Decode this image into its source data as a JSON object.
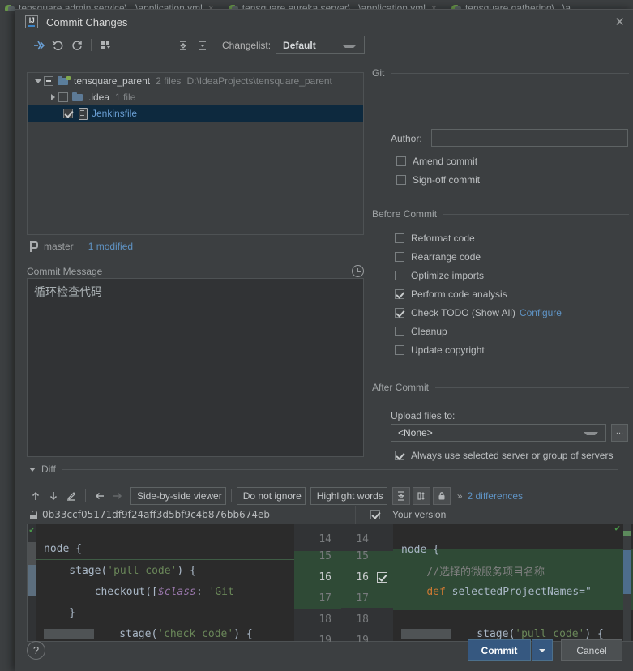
{
  "editor_tabs": [
    {
      "label": "tensquare admin service\\...\\application.yml",
      "icon": "yaml-file-icon",
      "close": "×"
    },
    {
      "label": "tensquare eureka server\\...\\application.yml",
      "icon": "yaml-file-icon",
      "close": "×"
    },
    {
      "label": "tensquare gathering\\...\\a",
      "icon": "yaml-file-icon",
      "close": ""
    }
  ],
  "dialog": {
    "title": "Commit Changes",
    "close_label": "✕",
    "logo": "intellij-idea-icon"
  },
  "toolbar": {
    "icons": [
      {
        "name": "show-diff-icon",
        "glyph": "⬌"
      },
      {
        "name": "revert-icon",
        "glyph": "↶"
      },
      {
        "name": "refresh-icon",
        "glyph": "↻"
      },
      {
        "name": "group-by-icon",
        "glyph": "⠿"
      },
      {
        "name": "expand-all-icon",
        "glyph": "⇕"
      },
      {
        "name": "collapse-all-icon",
        "glyph": "⇕"
      }
    ],
    "changelist_label": "Changelist:",
    "changelist_value": "Default"
  },
  "file_tree": {
    "rows": [
      {
        "name": "tensquare_parent",
        "meta": "2 files",
        "path": "D:\\IdeaProjects\\tensquare_parent",
        "checkbox": "dash",
        "twisty": "down",
        "icon": "module-folder-icon",
        "indent": 0,
        "selected": false,
        "modified": false
      },
      {
        "name": ".idea",
        "meta": "1 file",
        "path": "",
        "checkbox": "unchecked",
        "twisty": "right",
        "icon": "folder-icon",
        "indent": 1,
        "selected": false,
        "modified": false
      },
      {
        "name": "Jenkinsfile",
        "meta": "",
        "path": "",
        "checkbox": "checked",
        "twisty": "none",
        "icon": "file-icon",
        "indent": 2,
        "selected": true,
        "modified": true
      }
    ]
  },
  "branch_bar": {
    "branch": "master",
    "modified": "1 modified",
    "icon": "branch-icon"
  },
  "commit_message": {
    "label": "Commit Message",
    "value": "循环检查代码",
    "history_icon": "clock-icon"
  },
  "git_section": {
    "title": "Git",
    "author_label": "Author:",
    "author_value": "",
    "checkboxes": [
      {
        "label": "Amend commit",
        "checked": false
      },
      {
        "label": "Sign-off commit",
        "checked": false
      }
    ]
  },
  "before_commit": {
    "title": "Before Commit",
    "checkboxes": [
      {
        "label": "Reformat code",
        "checked": false,
        "link": ""
      },
      {
        "label": "Rearrange code",
        "checked": false,
        "link": ""
      },
      {
        "label": "Optimize imports",
        "checked": false,
        "link": ""
      },
      {
        "label": "Perform code analysis",
        "checked": true,
        "link": ""
      },
      {
        "label": "Check TODO (Show All)",
        "checked": true,
        "link": "Configure"
      },
      {
        "label": "Cleanup",
        "checked": false,
        "link": ""
      },
      {
        "label": "Update copyright",
        "checked": false,
        "link": ""
      }
    ]
  },
  "after_commit": {
    "title": "After Commit",
    "upload_label": "Upload files to:",
    "upload_value": "<None>",
    "browse_label": "...",
    "always_use_label": "Always use selected server or group of servers",
    "always_use_checked": true
  },
  "diff_section": {
    "title": "Diff",
    "toolbar": {
      "prev_diff_icon": "arrow-up-icon",
      "next_diff_icon": "arrow-down-icon",
      "edit_icon": "pencil-icon",
      "apply_left_icon": "arrow-left-icon",
      "apply_right_icon": "arrow-right-icon",
      "viewer_mode": "Side-by-side viewer",
      "ignore_mode": "Do not ignore",
      "highlight_mode": "Highlight words",
      "collapse_icon": "collapse-unchanged-icon",
      "whitespace_icon": "show-whitespace-icon",
      "lock_icon": "read-only-lock-icon",
      "more_glyph": "»",
      "differences": "2 differences"
    },
    "left_revision": "0b33ccf05171df9f24aff3d5bf9c4b876bb674eb",
    "left_revision_icon": "lock-icon",
    "right_revision": "Your version",
    "right_revision_checked": true,
    "line_numbers_left": [
      "14",
      "15",
      "16",
      "17",
      "18",
      "19"
    ],
    "line_numbers_right": [
      "14",
      "15",
      "16",
      "17",
      "18",
      "19"
    ],
    "left_lines": [
      {
        "indent": 0,
        "tokens": [
          {
            "t": "node {",
            "c": "txt"
          }
        ],
        "added": false
      },
      {
        "indent": 0,
        "tokens": [
          {
            "t": "    stage(",
            "c": "txt"
          },
          {
            "t": "'pull code'",
            "c": "str"
          },
          {
            "t": ") {",
            "c": "txt"
          }
        ],
        "added": false
      },
      {
        "indent": 0,
        "tokens": [
          {
            "t": "        checkout([",
            "c": "txt"
          },
          {
            "t": "$class",
            "c": "fld"
          },
          {
            "t": ": ",
            "c": "txt"
          },
          {
            "t": "'Git",
            "c": "str"
          }
        ],
        "added": false
      },
      {
        "indent": 0,
        "tokens": [
          {
            "t": "    }",
            "c": "txt"
          }
        ],
        "added": false
      },
      {
        "indent": 0,
        "tokens": [
          {
            "t": "    stage(",
            "c": "txt"
          },
          {
            "t": "'check code'",
            "c": "str"
          },
          {
            "t": ") {",
            "c": "txt"
          }
        ],
        "added": false
      }
    ],
    "right_lines": [
      {
        "tokens": [
          {
            "t": "node {",
            "c": "txt"
          }
        ],
        "added": false
      },
      {
        "tokens": [
          {
            "t": "    //选择的微服务项目名称",
            "c": "cmt"
          }
        ],
        "added": true
      },
      {
        "tokens": [
          {
            "t": "    ",
            "c": "txt"
          },
          {
            "t": "def",
            "c": "kw"
          },
          {
            "t": " selectedProjectNames=\"",
            "c": "txt"
          }
        ],
        "added": true
      },
      {
        "tokens": [
          {
            "t": "",
            "c": "txt"
          }
        ],
        "added": true
      },
      {
        "tokens": [
          {
            "t": "    stage(",
            "c": "txt"
          },
          {
            "t": "'pull code'",
            "c": "str"
          },
          {
            "t": ") {",
            "c": "txt"
          }
        ],
        "added": false
      }
    ]
  },
  "buttons": {
    "help": "?",
    "commit": "Commit",
    "commit_dropdown": "▾",
    "cancel": "Cancel"
  },
  "colors": {
    "accent_blue": "#365880",
    "link_blue": "#5f93c4",
    "added_green": "#2f4a36",
    "selection": "#0d293e",
    "bg": "#3c3f41",
    "editor_bg": "#2b2b2b"
  }
}
